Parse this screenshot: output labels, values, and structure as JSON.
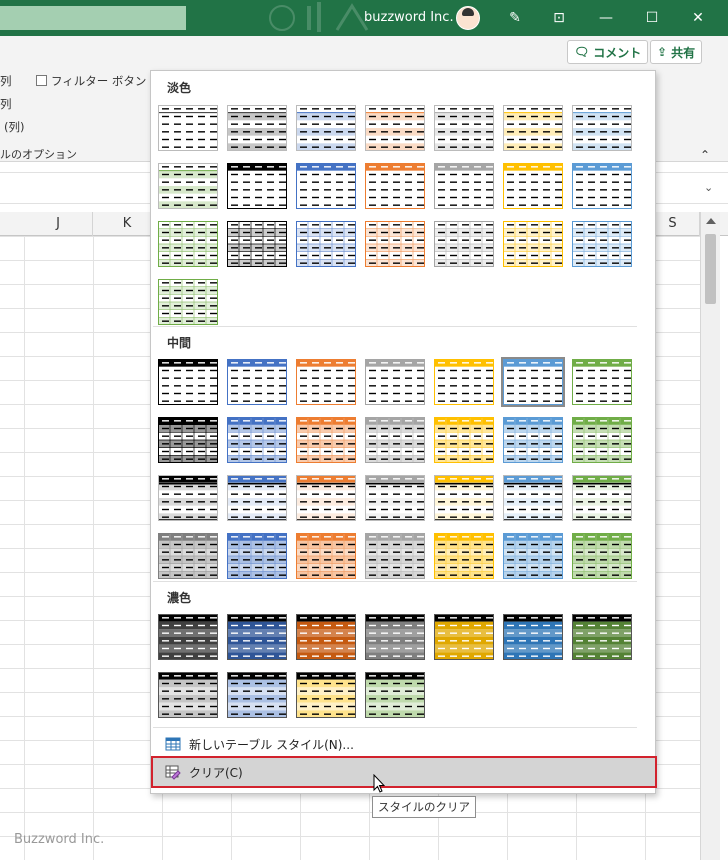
{
  "titlebar": {
    "company": "buzzword Inc."
  },
  "ribbon": {
    "comment_label": "コメント",
    "share_label": "共有",
    "opt_row1": "列",
    "filter_button_label": "フィルター ボタン",
    "opt_row2": "列",
    "opt_row3": "(列)",
    "group_label": "ルのオプション"
  },
  "columns": [
    "J",
    "K",
    "S"
  ],
  "watermark": "Buzzword Inc.",
  "gallery": {
    "light": {
      "title": "淡色",
      "tiles": [
        {
          "color": "#333333",
          "style": "plain"
        },
        {
          "color": "#333333",
          "style": "band"
        },
        {
          "color": "#4472c4",
          "style": "band"
        },
        {
          "color": "#ed7d31",
          "style": "band"
        },
        {
          "color": "#a5a5a5",
          "style": "band"
        },
        {
          "color": "#ffc000",
          "style": "band"
        },
        {
          "color": "#5b9bd5",
          "style": "band"
        },
        {
          "color": "#70ad47",
          "style": "band"
        },
        {
          "color": "#000000",
          "style": "outline"
        },
        {
          "color": "#4472c4",
          "style": "outline"
        },
        {
          "color": "#ed7d31",
          "style": "outline"
        },
        {
          "color": "#a5a5a5",
          "style": "outline"
        },
        {
          "color": "#ffc000",
          "style": "outline"
        },
        {
          "color": "#5b9bd5",
          "style": "outline"
        },
        {
          "color": "#70ad47",
          "style": "grid"
        },
        {
          "color": "#000000",
          "style": "grid"
        },
        {
          "color": "#4472c4",
          "style": "grid"
        },
        {
          "color": "#ed7d31",
          "style": "grid"
        },
        {
          "color": "#a5a5a5",
          "style": "grid"
        },
        {
          "color": "#ffc000",
          "style": "grid"
        },
        {
          "color": "#5b9bd5",
          "style": "grid"
        },
        {
          "color": "#70ad47",
          "style": "grid"
        }
      ]
    },
    "medium": {
      "title": "中間",
      "selected_index": 5,
      "tiles": [
        {
          "color": "#000000",
          "style": "head"
        },
        {
          "color": "#4472c4",
          "style": "head"
        },
        {
          "color": "#ed7d31",
          "style": "head"
        },
        {
          "color": "#a5a5a5",
          "style": "head"
        },
        {
          "color": "#ffc000",
          "style": "head"
        },
        {
          "color": "#5b9bd5",
          "style": "head"
        },
        {
          "color": "#70ad47",
          "style": "head"
        },
        {
          "color": "#000000",
          "style": "headgrid"
        },
        {
          "color": "#4472c4",
          "style": "headgrid"
        },
        {
          "color": "#ed7d31",
          "style": "headgrid"
        },
        {
          "color": "#a5a5a5",
          "style": "headgrid"
        },
        {
          "color": "#ffc000",
          "style": "headgrid"
        },
        {
          "color": "#5b9bd5",
          "style": "headgrid"
        },
        {
          "color": "#70ad47",
          "style": "headgrid"
        },
        {
          "color": "#000000",
          "style": "heavy"
        },
        {
          "color": "#4472c4",
          "style": "heavy"
        },
        {
          "color": "#ed7d31",
          "style": "heavy"
        },
        {
          "color": "#a5a5a5",
          "style": "heavy"
        },
        {
          "color": "#ffc000",
          "style": "heavy"
        },
        {
          "color": "#5b9bd5",
          "style": "heavy"
        },
        {
          "color": "#70ad47",
          "style": "heavy"
        },
        {
          "color": "#7f7f7f",
          "style": "fillgrid"
        },
        {
          "color": "#4472c4",
          "style": "fillgrid"
        },
        {
          "color": "#ed7d31",
          "style": "fillgrid"
        },
        {
          "color": "#a5a5a5",
          "style": "fillgrid"
        },
        {
          "color": "#ffc000",
          "style": "fillgrid"
        },
        {
          "color": "#5b9bd5",
          "style": "fillgrid"
        },
        {
          "color": "#70ad47",
          "style": "fillgrid"
        }
      ]
    },
    "dark": {
      "title": "濃色",
      "tiles": [
        {
          "color": "#404040",
          "style": "dark"
        },
        {
          "color": "#2f5597",
          "style": "dark"
        },
        {
          "color": "#c55a11",
          "style": "dark"
        },
        {
          "color": "#7f7f7f",
          "style": "dark"
        },
        {
          "color": "#e0a800",
          "style": "dark"
        },
        {
          "color": "#2e75b6",
          "style": "dark"
        },
        {
          "color": "#548235",
          "style": "dark"
        },
        {
          "color": "#7f7f7f",
          "style": "darklight"
        },
        {
          "color": "#4472c4",
          "style": "darklight"
        },
        {
          "color": "#ffc000",
          "style": "darklight"
        },
        {
          "color": "#70ad47",
          "style": "darklight"
        }
      ]
    },
    "new_style_label": "新しいテーブル スタイル(N)...",
    "clear_label": "クリア(C)",
    "tooltip": "スタイルのクリア"
  }
}
